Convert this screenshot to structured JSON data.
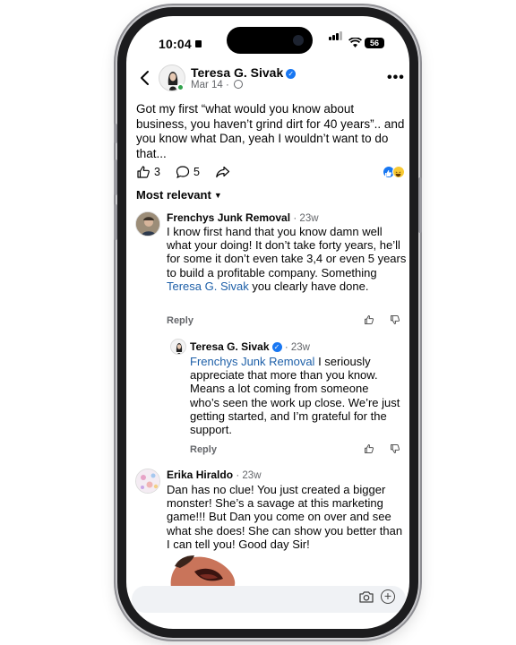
{
  "status": {
    "time": "10:04",
    "battery": "56"
  },
  "post": {
    "author": "Teresa G. Sivak",
    "date": "Mar 14 ·",
    "text": "Got my first “what would you know about business, you haven’t grind dirt for 40 years”.. and you know what Dan, yeah I wouldn’t want to do that...",
    "likes": "3",
    "comments": "5"
  },
  "sort_label": "Most relevant",
  "comments": [
    {
      "name": "Frenchys Junk Removal",
      "time": "· 23w",
      "text_before": "I know first hand that you know damn well what your doing! It don’t take forty years, he’ll for some it don’t even take 3,4 or even 5 years to build a profitable company. Something ",
      "mention": "Teresa G. Sivak",
      "text_after": " you clearly have done.",
      "reply_label": "Reply"
    },
    {
      "name": "Teresa G. Sivak",
      "time": "· 23w",
      "mention": "Frenchys Junk Removal",
      "text_after": " I seriously appreciate that more than you know. Means a lot coming from someone who’s seen the work up close. We’re just getting started, and I’m grateful for the support.",
      "reply_label": "Reply"
    },
    {
      "name": "Erika Hiraldo",
      "time": "· 23w",
      "text": "Dan has no clue! You just created a bigger monster! She’s a savage at this marketing game!!! But Dan you come on over and see what she does! She can show you better than I can tell you! Good day Sir!"
    }
  ],
  "colors": {
    "accent": "#1877f2",
    "mention": "#1d5fa8",
    "online": "#31a24c",
    "muted": "#65676b"
  },
  "icons": [
    "back-arrow-icon",
    "verified-badge-icon",
    "globe-icon",
    "more-icon",
    "like-icon",
    "comment-icon",
    "share-icon",
    "like-reaction-icon",
    "haha-reaction-icon",
    "chevron-down-icon",
    "thumb-up-icon",
    "thumb-down-icon",
    "camera-icon",
    "plus-icon"
  ]
}
